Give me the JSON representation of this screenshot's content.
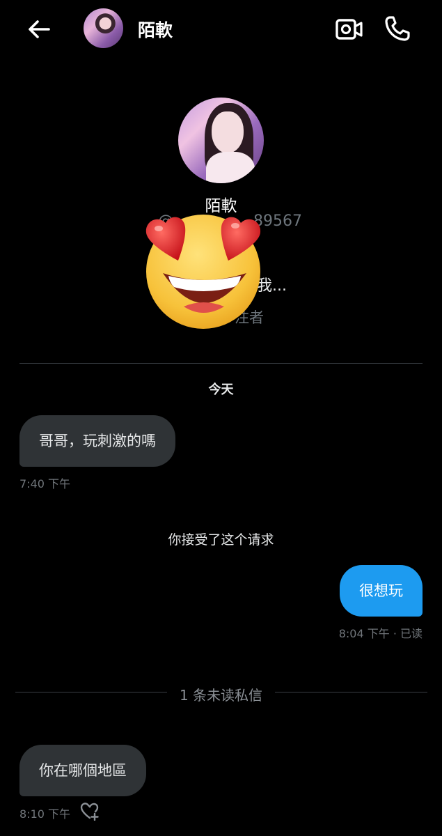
{
  "header": {
    "title": "陌軟",
    "icons": {
      "back": "arrow-left-icon",
      "video": "video-camera-icon",
      "call": "phone-icon"
    }
  },
  "profile": {
    "name": "陌軟",
    "handle_visible": "@",
    "handle_visible_end": "89567",
    "bio_visible_end": "我...",
    "followers_visible_end": "注者",
    "overlay": "heart-eyes-emoji"
  },
  "conversation": {
    "date_label": "今天",
    "messages": [
      {
        "direction": "in",
        "text": "哥哥，玩刺激的嗎",
        "time": "7:40 下午"
      },
      {
        "direction": "out",
        "text": "很想玩",
        "time": "8:04 下午 · 已读"
      },
      {
        "direction": "in",
        "text": "你在哪個地區",
        "time": "8:10 下午"
      }
    ],
    "system_note": "你接受了这个请求",
    "unread_divider": "1 条未读私信"
  },
  "colors": {
    "background": "#000000",
    "bubble_in": "#2f3336",
    "bubble_out": "#1d9bf0",
    "muted": "#71767b"
  }
}
